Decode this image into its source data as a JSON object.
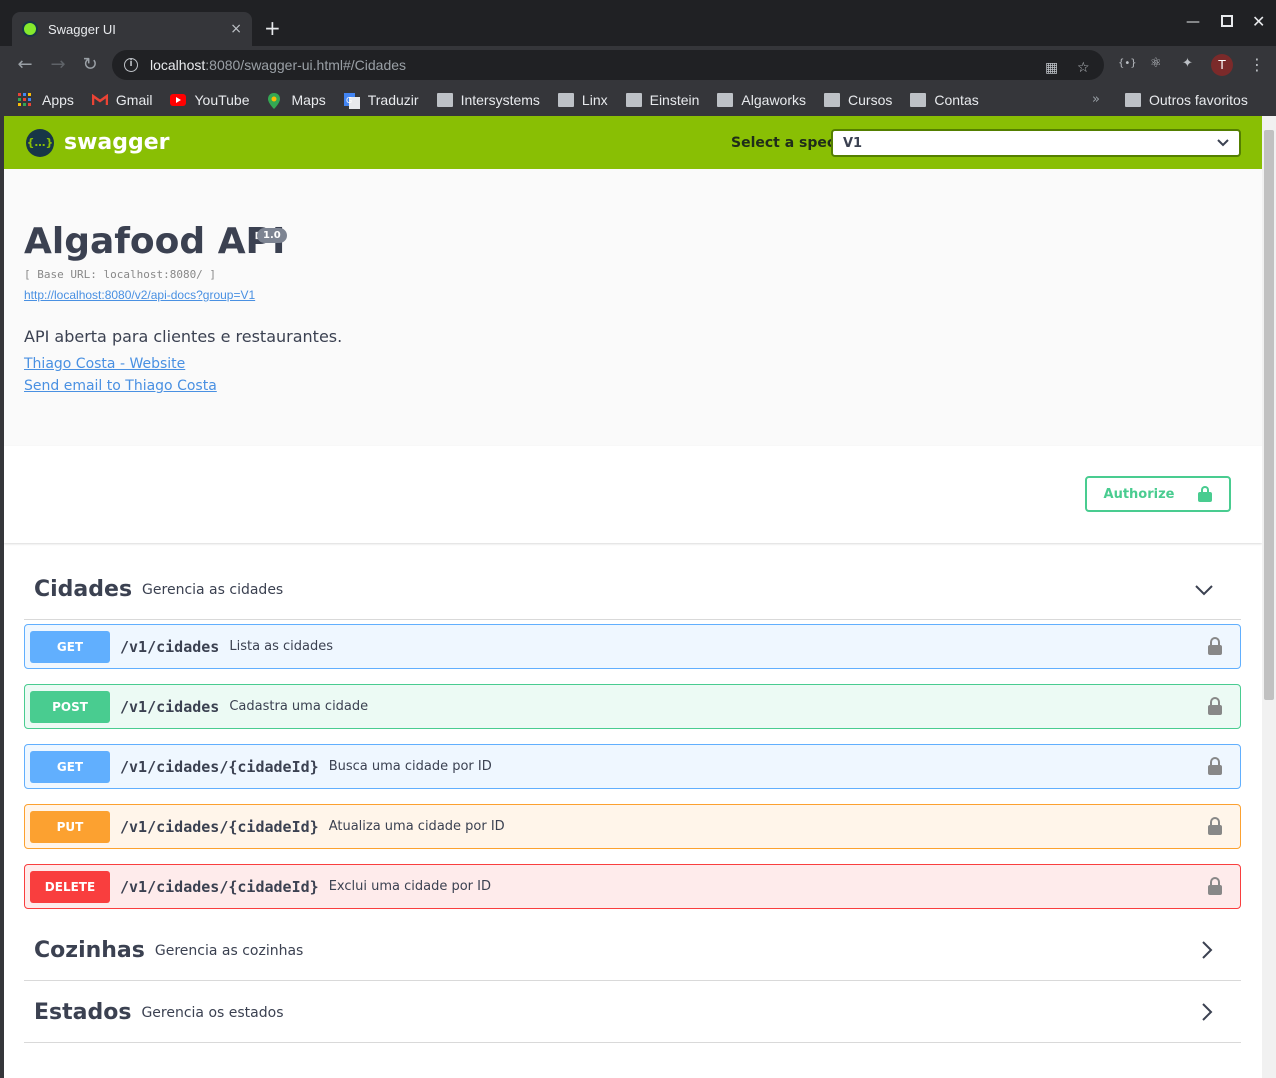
{
  "browser": {
    "tab_title": "Swagger UI",
    "tab_close": "×",
    "new_tab": "+",
    "url_host": "localhost",
    "url_path": ":8080/swagger-ui.html#/Cidades",
    "profile_initial": "T",
    "bookmarks": [
      {
        "label": "Apps",
        "icon": "apps-grid-icon"
      },
      {
        "label": "Gmail",
        "icon": "gmail-icon"
      },
      {
        "label": "YouTube",
        "icon": "youtube-icon"
      },
      {
        "label": "Maps",
        "icon": "maps-pin-icon"
      },
      {
        "label": "Traduzir",
        "icon": "translate-icon"
      },
      {
        "label": "Intersystems",
        "icon": "folder-icon"
      },
      {
        "label": "Linx",
        "icon": "folder-icon"
      },
      {
        "label": "Einstein",
        "icon": "folder-icon"
      },
      {
        "label": "Algaworks",
        "icon": "folder-icon"
      },
      {
        "label": "Cursos",
        "icon": "folder-icon"
      },
      {
        "label": "Contas",
        "icon": "folder-icon"
      }
    ],
    "bookmarks_more": "»",
    "other_bookmarks": "Outros favoritos"
  },
  "swagger": {
    "logo_text": "swagger",
    "logo_glyph": "{…}",
    "spec_label": "Select a spec",
    "spec_value": "V1"
  },
  "info": {
    "title": "Algafood API",
    "version": "1.0",
    "base_url": "[ Base URL: localhost:8080/ ]",
    "spec_link": "http://localhost:8080/v2/api-docs?group=V1",
    "description": "API aberta para clientes e restaurantes.",
    "website_link": "Thiago Costa - Website",
    "email_link": "Send email to Thiago Costa"
  },
  "auth": {
    "authorize_label": "Authorize"
  },
  "tags": [
    {
      "name": "Cidades",
      "description": "Gerencia as cidades",
      "expanded": true
    },
    {
      "name": "Cozinhas",
      "description": "Gerencia as cozinhas",
      "expanded": false
    },
    {
      "name": "Estados",
      "description": "Gerencia os estados",
      "expanded": false
    }
  ],
  "operations": [
    {
      "method": "GET",
      "path": "/v1/cidades",
      "summary": "Lista as cidades"
    },
    {
      "method": "POST",
      "path": "/v1/cidades",
      "summary": "Cadastra uma cidade"
    },
    {
      "method": "GET",
      "path": "/v1/cidades/{cidadeId}",
      "summary": "Busca uma cidade por ID"
    },
    {
      "method": "PUT",
      "path": "/v1/cidades/{cidadeId}",
      "summary": "Atualiza uma cidade por ID"
    },
    {
      "method": "DELETE",
      "path": "/v1/cidades/{cidadeId}",
      "summary": "Exclui uma cidade por ID"
    }
  ],
  "colors": {
    "topbar": "#89bf04",
    "get": "#61affe",
    "post": "#49cc90",
    "put": "#fca130",
    "delete": "#f93e3e"
  }
}
